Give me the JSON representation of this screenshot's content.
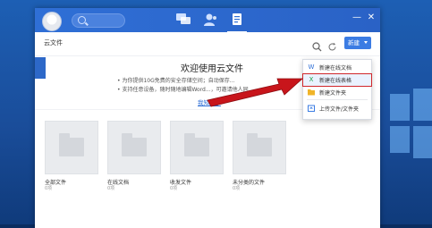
{
  "colors": {
    "accent": "#2f6fd6",
    "arrow": "#c8151b",
    "highlight_border": "#d0262a"
  },
  "titlebar": {
    "nav_icons": [
      "chat-icon",
      "contacts-icon",
      "cloud-file-icon"
    ],
    "window_controls": [
      "—",
      "✕"
    ]
  },
  "toolbar": {
    "breadcrumb": "云文件",
    "new_button": "新建"
  },
  "welcome": {
    "title": "欢迎使用云文件",
    "line1": "• 为你提供10G免费的安全存储空间；自动保存...",
    "line2": "• 支持任意设备，随时随地编辑Word...，可邀请他人同...",
    "link": "我知道了"
  },
  "folders": [
    {
      "name": "全部文件",
      "count": "0项"
    },
    {
      "name": "在线文档",
      "count": "0项"
    },
    {
      "name": "收发文件",
      "count": "0项"
    },
    {
      "name": "未分类的文件",
      "count": "0项"
    }
  ],
  "dropdown": {
    "items": [
      {
        "label": "新建在线文档",
        "icon": "online-doc-icon"
      },
      {
        "label": "新建在线表格",
        "icon": "online-sheet-icon"
      },
      {
        "label": "新建文件夹",
        "icon": "folder-icon"
      },
      {
        "label": "上传文件/文件夹",
        "icon": "upload-icon"
      }
    ]
  }
}
